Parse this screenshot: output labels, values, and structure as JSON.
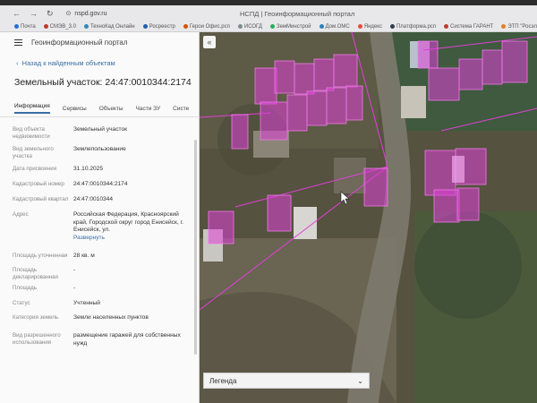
{
  "browser": {
    "window_title": "НСПД | Геоинформационный портал",
    "url": "nspd.gov.ru",
    "bookmarks": [
      {
        "label": "Почта",
        "color": "#2a6dd6"
      },
      {
        "label": "СМЭВ_3.0",
        "color": "#c0392b"
      },
      {
        "label": "ТехноКад Онлайн",
        "color": "#2e86c1"
      },
      {
        "label": "Росреестр",
        "color": "#1f5fae"
      },
      {
        "label": "Герои Офис.рсп",
        "color": "#d35400"
      },
      {
        "label": "ИСОГД",
        "color": "#7f8c8d"
      },
      {
        "label": "ЗемМинстрой",
        "color": "#27ae60"
      },
      {
        "label": "Дом.ОМС",
        "color": "#2980b9"
      },
      {
        "label": "Яндекс",
        "color": "#e74c3c"
      },
      {
        "label": "Платформа.рсп",
        "color": "#2c3e50"
      },
      {
        "label": "Система ГАРАНТ",
        "color": "#c0392b"
      },
      {
        "label": "ЭТП \"Росэлторг\"",
        "color": "#e67e22"
      }
    ]
  },
  "panel": {
    "portal_title": "Геоинформационный портал",
    "back_link": "Назад к найденным объектам",
    "parcel_title": "Земельный участок: 24:47:0010344:2174",
    "tabs": [
      "Информация",
      "Сервисы",
      "Объекты",
      "Части ЗУ",
      "Систе"
    ],
    "properties": [
      {
        "key": "Вид объекта недвижимости",
        "value": "Земельный участок"
      },
      {
        "key": "Вид земельного участка",
        "value": "Землепользование"
      },
      {
        "key": "Дата присвоения",
        "value": "31.10.2025"
      },
      {
        "key": "Кадастровый номер",
        "value": "24:47:0010344:2174"
      },
      {
        "key": "Кадастровый квартал",
        "value": "24:47:0010344"
      },
      {
        "key": "Адрес",
        "value": "Российская Федерация, Красноярский край, Городской округ город Енисейск, г. Енисейск, ул.",
        "link": "Развернуть"
      },
      {
        "key": "Площадь уточненная",
        "value": "28 кв. м"
      },
      {
        "key": "Площадь декларированная",
        "value": "-"
      },
      {
        "key": "Площадь",
        "value": "-"
      },
      {
        "key": "Статус",
        "value": "Учтенный"
      },
      {
        "key": "Категория земель",
        "value": "Земли населенных пунктов"
      },
      {
        "key": "Вид разрешенного использования",
        "value": "размещение гаражей для собственных нужд"
      }
    ]
  },
  "map": {
    "collapse_glyph": "«",
    "legend_label": "Легенда",
    "legend_chevron": "⌄",
    "parcel_color": "#e040d8"
  }
}
